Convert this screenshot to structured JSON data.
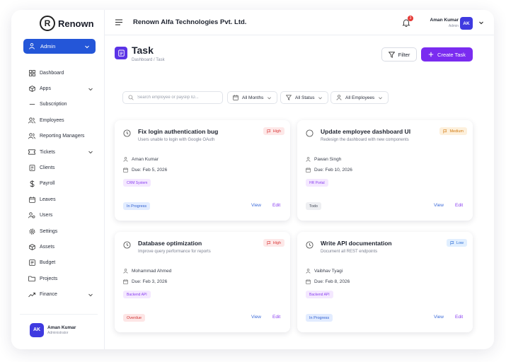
{
  "app": {
    "brand": "Renown",
    "brand_mark": "R",
    "company": "Renown Alfa Technologies Pvt. Ltd."
  },
  "colors": {
    "primary": "#2456d8",
    "accent": "#7a2cf0",
    "avatar": "#3f3ae0"
  },
  "sidebar": {
    "role": "Admin",
    "items": [
      {
        "label": "Dashboard",
        "icon": "dashboard-icon",
        "chevron": false
      },
      {
        "label": "Apps",
        "icon": "apps-icon",
        "chevron": true
      },
      {
        "label": "Subscription",
        "icon": "subscription-icon",
        "chevron": false
      },
      {
        "label": "Employees",
        "icon": "employees-icon",
        "chevron": false
      },
      {
        "label": "Reporting Managers",
        "icon": "managers-icon",
        "chevron": false
      },
      {
        "label": "Tickets",
        "icon": "ticket-icon",
        "chevron": true
      },
      {
        "label": "Clients",
        "icon": "clients-icon",
        "chevron": false
      },
      {
        "label": "Payroll",
        "icon": "dollar-icon",
        "chevron": false
      },
      {
        "label": "Leaves",
        "icon": "leaves-icon",
        "chevron": false
      },
      {
        "label": "Users",
        "icon": "users-icon",
        "chevron": false
      },
      {
        "label": "Settings",
        "icon": "gear-icon",
        "chevron": false
      },
      {
        "label": "Assets",
        "icon": "assets-icon",
        "chevron": false
      },
      {
        "label": "Budget",
        "icon": "budget-icon",
        "chevron": false
      },
      {
        "label": "Projects",
        "icon": "folder-icon",
        "chevron": false
      },
      {
        "label": "Finance",
        "icon": "trend-icon",
        "chevron": true
      }
    ],
    "user": {
      "initials": "AK",
      "name": "Aman Kumar",
      "role": "Administrator"
    }
  },
  "header": {
    "notification_count": "3",
    "user": {
      "name": "Aman Kumar",
      "role": "Admin",
      "initials": "AK"
    }
  },
  "page": {
    "title": "Task",
    "breadcrumb": "Dashboard / Task",
    "filter_label": "Filter",
    "create_label": "Create Task"
  },
  "filters": {
    "search_placeholder": "Search employee or payslip ID...",
    "months": "All Months",
    "status": "All Status",
    "employees": "All Employees"
  },
  "tasks": [
    {
      "title": "Fix login authentication bug",
      "description": "Users unable to login with Google OAuth",
      "priority": "High",
      "assignee": "Aman Kumar",
      "due": "Due: Feb 5, 2026",
      "project": "CRM System",
      "status": "In Progress",
      "done_icon": "clock-icon"
    },
    {
      "title": "Update employee dashboard UI",
      "description": "Redesign the dashboard with new components",
      "priority": "Medium",
      "assignee": "Pawan Singh",
      "due": "Due: Feb 10, 2026",
      "project": "HR Portal",
      "status": "Todo",
      "done_icon": "circle-icon"
    },
    {
      "title": "Database optimization",
      "description": "Improve query performance for reports",
      "priority": "High",
      "assignee": "Mohammad Ahmed",
      "due": "Due: Feb 3, 2026",
      "project": "Backend API",
      "status": "Overdue",
      "done_icon": "clock-icon"
    },
    {
      "title": "Write API documentation",
      "description": "Document all REST endpoints",
      "priority": "Low",
      "assignee": "Vaibhav Tyagi",
      "due": "Due: Feb 8, 2026",
      "project": "Backend API",
      "status": "In Progress",
      "done_icon": "clock-icon"
    }
  ],
  "actions": {
    "view": "View",
    "edit": "Edit"
  }
}
